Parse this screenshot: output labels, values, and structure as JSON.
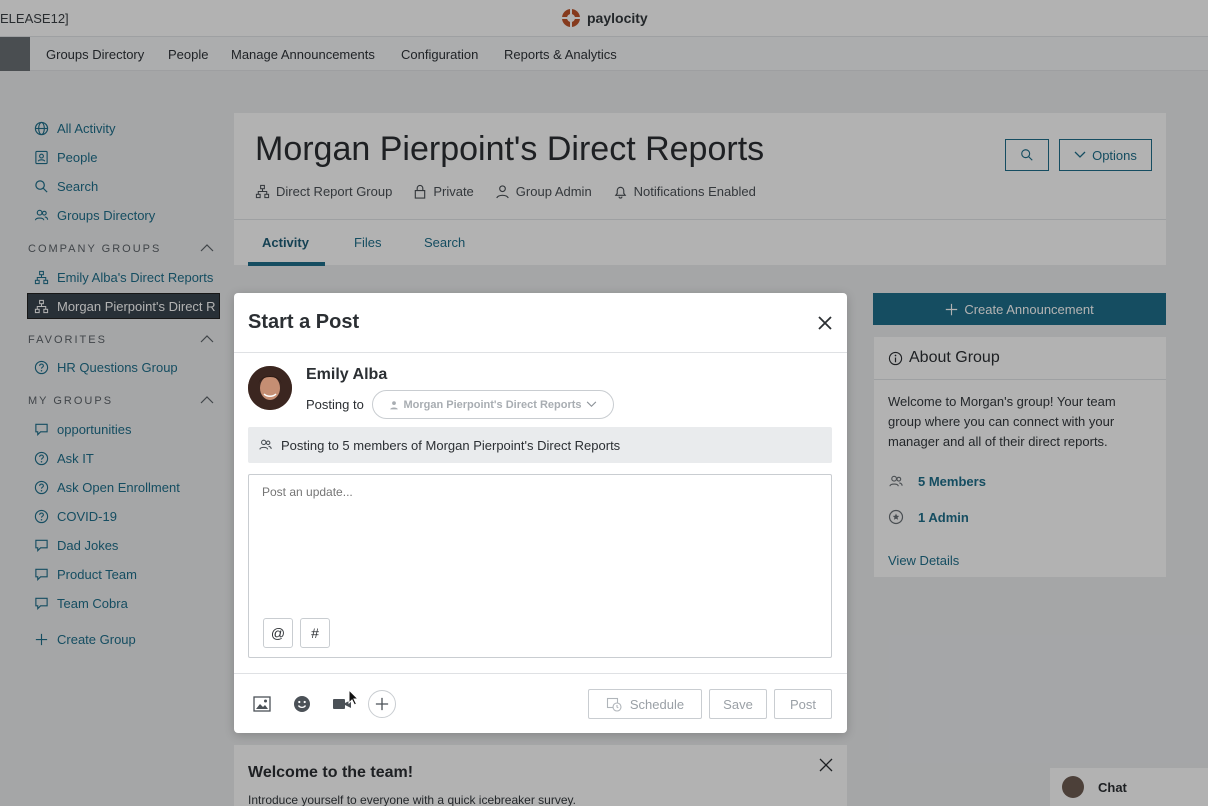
{
  "topbar": {
    "env_label": "ELEASE12]",
    "logo_text": "paylocity"
  },
  "nav": {
    "items": [
      "Groups Directory",
      "People",
      "Manage Announcements",
      "Configuration",
      "Reports & Analytics"
    ]
  },
  "sidebar": {
    "main": [
      {
        "label": "All Activity",
        "icon": "globe-icon"
      },
      {
        "label": "People",
        "icon": "person-card-icon"
      },
      {
        "label": "Search",
        "icon": "search-icon"
      },
      {
        "label": "Groups Directory",
        "icon": "users-icon"
      }
    ],
    "company_groups_title": "COMPANY GROUPS",
    "company_groups": [
      {
        "label": "Emily Alba's Direct Reports"
      },
      {
        "label": "Morgan Pierpoint's Direct R"
      }
    ],
    "favorites_title": "FAVORITES",
    "favorites": [
      {
        "label": "HR Questions Group"
      }
    ],
    "my_groups_title": "MY GROUPS",
    "my_groups": [
      {
        "label": "opportunities",
        "icon": "chat-icon"
      },
      {
        "label": "Ask IT",
        "icon": "question-icon"
      },
      {
        "label": "Ask Open Enrollment",
        "icon": "question-icon"
      },
      {
        "label": "COVID-19",
        "icon": "question-icon"
      },
      {
        "label": "Dad Jokes",
        "icon": "chat-icon"
      },
      {
        "label": "Product Team",
        "icon": "chat-icon"
      },
      {
        "label": "Team Cobra",
        "icon": "chat-icon"
      }
    ],
    "create_group": "Create Group"
  },
  "group": {
    "title": "Morgan Pierpoint's Direct Reports",
    "meta": [
      "Direct Report Group",
      "Private",
      "Group Admin",
      "Notifications Enabled"
    ],
    "options_label": "Options",
    "tabs": [
      "Activity",
      "Files",
      "Search"
    ]
  },
  "right": {
    "create_announcement": "Create Announcement",
    "about_title": "About Group",
    "about_desc": "Welcome to Morgan's group! Your team group where you can connect with your manager and all of their direct reports.",
    "members": "5 Members",
    "admins": "1 Admin",
    "view_details": "View Details"
  },
  "welcome": {
    "title": "Welcome to the team!",
    "text": "Introduce yourself to everyone with a quick icebreaker survey."
  },
  "chat": {
    "label": "Chat"
  },
  "modal": {
    "title": "Start a Post",
    "user_name": "Emily Alba",
    "posting_to_label": "Posting to",
    "posting_to_value": "Morgan Pierpoint's Direct Reports",
    "banner": "Posting to 5 members of Morgan Pierpoint's Direct Reports",
    "placeholder": "Post an update...",
    "mention_symbol": "@",
    "hashtag_symbol": "#",
    "schedule_label": "Schedule",
    "save_label": "Save",
    "post_label": "Post"
  },
  "colors": {
    "accent": "#1f6f8b",
    "active_sidebar": "#3a4650"
  }
}
